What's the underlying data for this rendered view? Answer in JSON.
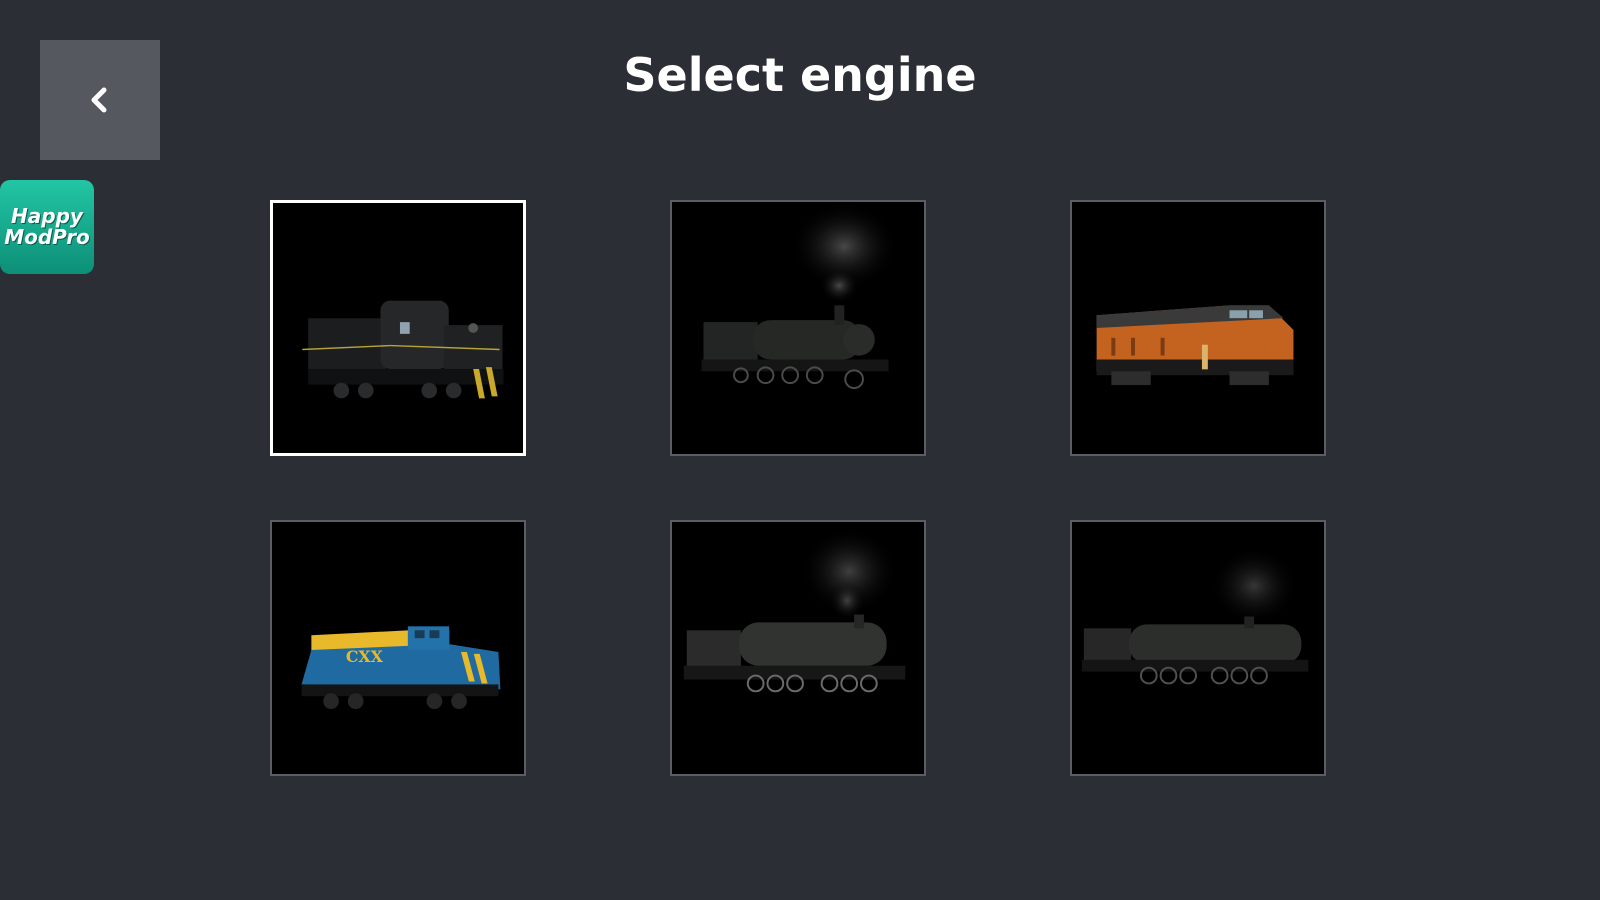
{
  "header": {
    "title": "Select engine"
  },
  "back_button": {
    "icon": "chevron-left-icon"
  },
  "badge": {
    "line1": "Happy",
    "line2": "ModPro"
  },
  "engines": [
    {
      "name": "diesel-switcher-black",
      "selected": true
    },
    {
      "name": "steam-tank-locomotive",
      "selected": false
    },
    {
      "name": "diesel-cab-orange",
      "selected": false
    },
    {
      "name": "diesel-cxx-blue-yellow",
      "selected": false
    },
    {
      "name": "steam-articulated-large",
      "selected": false
    },
    {
      "name": "steam-big-boy",
      "selected": false
    }
  ],
  "colors": {
    "background": "#2b2e35",
    "card_border": "#5a5e64",
    "selected_border": "#ffffff",
    "back_button": "#55595f"
  }
}
